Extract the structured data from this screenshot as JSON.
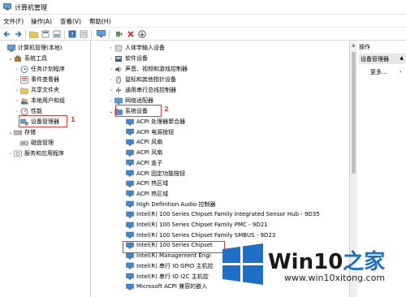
{
  "window": {
    "title": "计算机管理"
  },
  "menu": [
    "文件(F)",
    "操作(A)",
    "查看(V)",
    "帮助(H)"
  ],
  "left_tree": {
    "root": "计算机管理(本地)",
    "system_tools": "系统工具",
    "task_scheduler": "任务计划程序",
    "event_viewer": "事件查看器",
    "shared_folders": "共享文件夹",
    "local_users": "本地用户和组",
    "performance": "性能",
    "device_manager": "设备管理器",
    "storage": "存储",
    "disk_management": "磁盘管理",
    "services": "服务和应用程序"
  },
  "annotations": {
    "one": "1",
    "two": "2"
  },
  "device_tree": {
    "categories": [
      "人体学输入设备",
      "软件设备",
      "声音、视频和游戏控制器",
      "鼠标和其他指针设备",
      "通用串行总线控制器",
      "网络适配器"
    ],
    "system_devices": "系统设备",
    "children": [
      "ACPI 处理器聚合器",
      "ACPI 电源按钮",
      "ACPI 风扇",
      "ACPI 风扇",
      "ACPI 盖子",
      "ACPI 固定功能按钮",
      "ACPI 热区域",
      "ACPI 热区域",
      "High Definition Audio 控制器",
      "Intel(R) 100 Series Chipset Family Integrated Sensor Hub - 9D35",
      "Intel(R) 100 Series Chipset Family PMC - 9D21",
      "Intel(R) 100 Series Chipset Family SMBUS - 9D23",
      "Intel(R) 100 Series Chipset",
      "Intel(R) Management Engi",
      "Intel(R) 串行 IO GPIO 主机控",
      "Intel(R) 串行 IO I2C 主机控",
      "Microsoft ACPI 兼容的嵌入"
    ]
  },
  "actions": {
    "header": "操作",
    "item": "设备管理器",
    "more": "更多..."
  },
  "watermark": {
    "brand_a": "Win10",
    "brand_b": "之家",
    "url": "www.win10xitong.com"
  }
}
